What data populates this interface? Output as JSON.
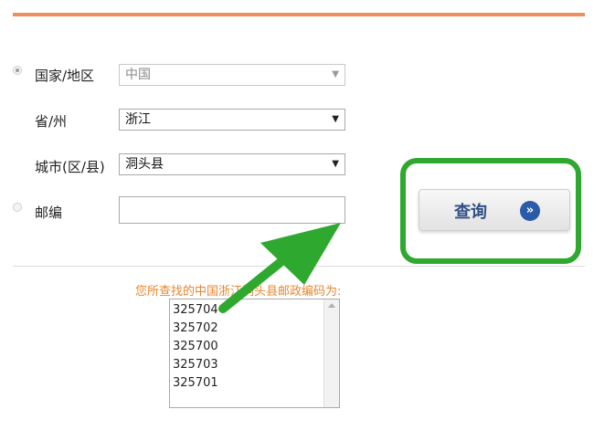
{
  "form": {
    "country": {
      "label": "国家/地区",
      "value": "中国",
      "disabled": true
    },
    "province": {
      "label": "省/州",
      "value": "浙江"
    },
    "city": {
      "label": "城市(区/县)",
      "value": "洞头县"
    },
    "postcode": {
      "label": "邮编",
      "value": ""
    }
  },
  "query_button": {
    "label": "查询",
    "icon": "double-chevron-right-icon",
    "glyph": "»"
  },
  "result": {
    "caption": "您所查找的中国浙江洞头县邮政编码为:",
    "codes": [
      "325704",
      "325702",
      "325700",
      "325703",
      "325701"
    ]
  },
  "colors": {
    "top_bar": "#ef8f5c",
    "caption": "#e8862f",
    "highlight_green": "#2ea82e",
    "button_text": "#2f4f86",
    "button_icon": "#2a5aa8"
  }
}
